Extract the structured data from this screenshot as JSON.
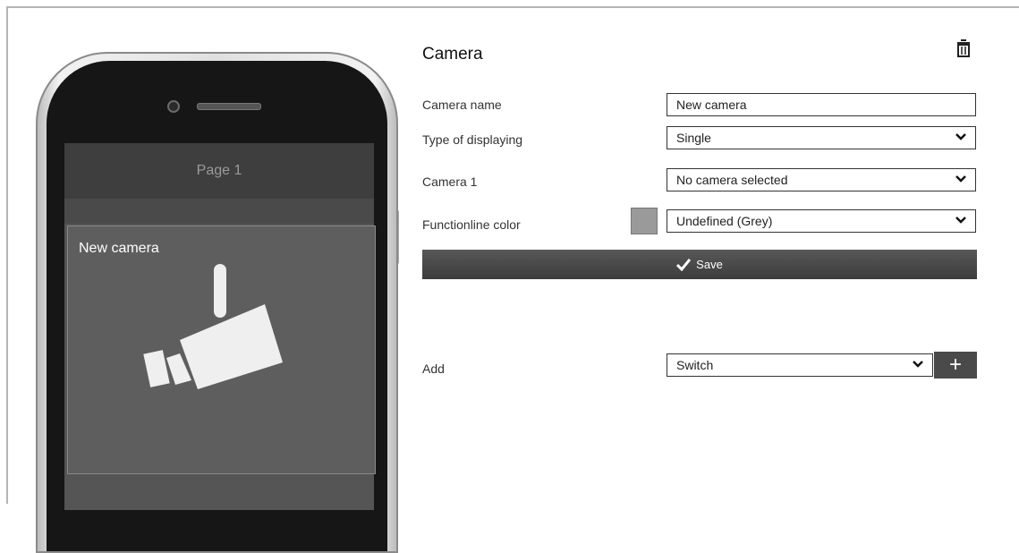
{
  "phone": {
    "page_title": "Page 1",
    "tile_label": "New camera",
    "tile_icon": "security-camera-icon"
  },
  "form": {
    "title": "Camera",
    "delete_icon": "trash-icon",
    "fields": {
      "camera_name": {
        "label": "Camera name",
        "value": "New camera"
      },
      "type_of_displaying": {
        "label": "Type of displaying",
        "value": "Single"
      },
      "camera_1": {
        "label": "Camera 1",
        "value": "No camera selected"
      },
      "functionline_color": {
        "label": "Functionline color",
        "value": "Undefined (Grey)",
        "swatch": "#9a9a9a"
      }
    },
    "save_label": "Save",
    "add": {
      "label": "Add",
      "value": "Switch",
      "button": "+"
    }
  }
}
